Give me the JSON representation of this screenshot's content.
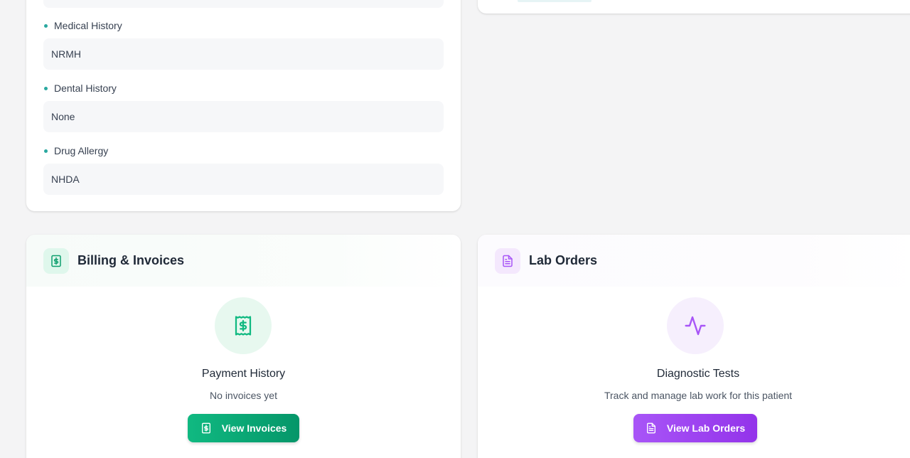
{
  "medical": {
    "fields": [
      {
        "label": "Medical History",
        "value": "NRMH"
      },
      {
        "label": "Dental History",
        "value": "None"
      },
      {
        "label": "Drug Allergy",
        "value": "NHDA"
      }
    ]
  },
  "billing": {
    "title": "Billing & Invoices",
    "icon": "receipt-dollar-icon",
    "section_title": "Payment History",
    "section_sub": "No invoices yet",
    "button_label": "View Invoices",
    "accent": "#10b981"
  },
  "lab": {
    "title": "Lab Orders",
    "icon": "document-icon",
    "section_title": "Diagnostic Tests",
    "section_sub": "Track and manage lab work for this patient",
    "button_label": "View Lab Orders",
    "accent": "#a855f7"
  }
}
